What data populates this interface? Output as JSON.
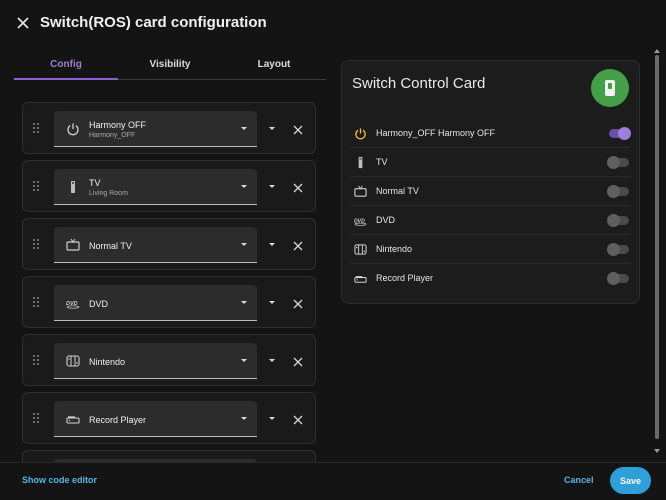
{
  "header": {
    "title": "Switch(ROS) card configuration",
    "close_icon": "close-icon"
  },
  "tabs": [
    {
      "label": "Config",
      "active": true
    },
    {
      "label": "Visibility",
      "active": false
    },
    {
      "label": "Layout",
      "active": false
    }
  ],
  "entities_editor": [
    {
      "name": "Harmony OFF",
      "secondary": "Harmony_OFF",
      "icon": "power-icon"
    },
    {
      "name": "TV",
      "secondary": "Living Room",
      "icon": "tv-remote-icon"
    },
    {
      "name": "Normal TV",
      "secondary": "",
      "icon": "television-icon"
    },
    {
      "name": "DVD",
      "secondary": "",
      "icon": "dvd-icon"
    },
    {
      "name": "Nintendo",
      "secondary": "",
      "icon": "nintendo-switch-icon"
    },
    {
      "name": "Record Player",
      "secondary": "",
      "icon": "record-player-icon"
    }
  ],
  "card": {
    "title": "Switch Control Card",
    "badge_icon": "remote-icon",
    "badge_color": "#43a047",
    "entities": [
      {
        "label": "Harmony_OFF Harmony OFF",
        "icon": "power-icon",
        "state": "on"
      },
      {
        "label": "TV",
        "icon": "tv-remote-icon",
        "state": "off"
      },
      {
        "label": "Normal TV",
        "icon": "television-icon",
        "state": "off"
      },
      {
        "label": "DVD",
        "icon": "dvd-icon",
        "state": "off"
      },
      {
        "label": "Nintendo",
        "icon": "nintendo-switch-icon",
        "state": "off"
      },
      {
        "label": "Record Player",
        "icon": "record-player-icon",
        "state": "off"
      }
    ]
  },
  "footer": {
    "code_editor_label": "Show code editor",
    "cancel_label": "Cancel",
    "save_label": "Save"
  },
  "colors": {
    "accent": "#8a63d2",
    "link": "#4fb6e8",
    "save_button": "#2e9fd8",
    "power_on": "#f4c430"
  }
}
